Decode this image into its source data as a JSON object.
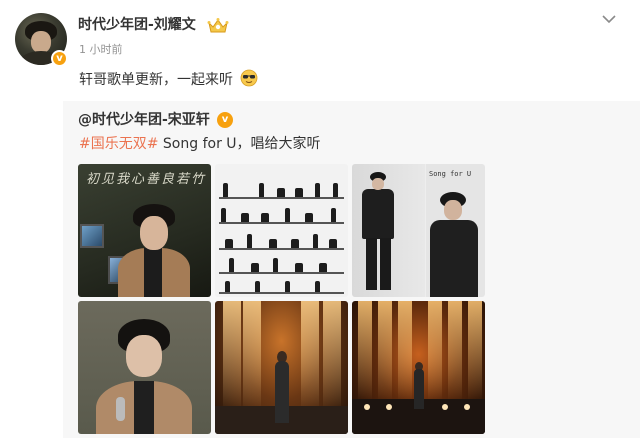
{
  "post": {
    "author": {
      "name": "时代少年团-刘耀文",
      "verified_color": "#f7a10f",
      "badge_icon": "crown-icon"
    },
    "time": "1 小时前",
    "text": "轩哥歌单更新，一起来听",
    "emoji": "sunglasses-emoji-icon",
    "menu_icon": "chevron-down-icon"
  },
  "repost": {
    "author_prefix": "@",
    "author_name": "时代少年团-宋亚轩",
    "hashtag": "#国乐无双#",
    "text": " Song for U，唱给大家听",
    "hashtag_color": "#eb7350",
    "images": [
      {
        "calligraphy": "初见我心善良若竹"
      },
      {},
      {
        "label": "Song for U"
      },
      {},
      {},
      {}
    ]
  }
}
